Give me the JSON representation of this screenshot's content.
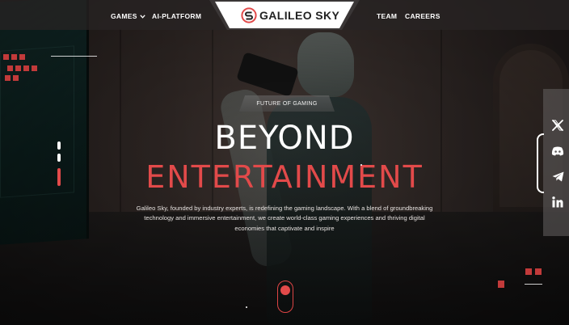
{
  "header": {
    "nav_left": [
      {
        "label": "GAMES",
        "has_dropdown": true,
        "icon": "chevron-down-icon"
      },
      {
        "label": "AI-PLATFORM",
        "has_dropdown": false
      }
    ],
    "logo_text": "GALILEO SKY",
    "nav_right": [
      {
        "label": "TEAM"
      },
      {
        "label": "CAREERS"
      }
    ]
  },
  "hero": {
    "tagline": "FUTURE OF GAMING",
    "title_line1": "BEYOND",
    "title_line2": "ENTERTAINMENT",
    "description": "Galileo Sky, founded by industry experts, is redefining the gaming landscape. With a blend of groundbreaking technology and immersive entertainment, we create world-class gaming experiences and thriving digital economies that captivate and inspire"
  },
  "social": [
    {
      "name": "x-icon"
    },
    {
      "name": "discord-icon"
    },
    {
      "name": "telegram-icon"
    },
    {
      "name": "linkedin-icon"
    }
  ],
  "colors": {
    "accent": "#e24a4a",
    "header_bg": "#2a2626",
    "text": "#ffffff",
    "sidebar_bg": "#5f5c5c"
  }
}
